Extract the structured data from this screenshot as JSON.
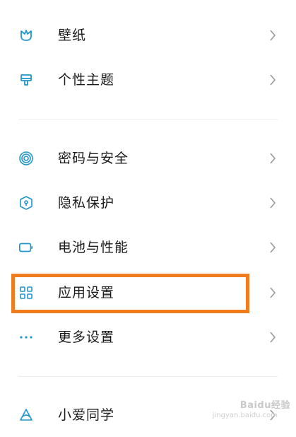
{
  "colors": {
    "accent": "#2196c9",
    "highlight_border": "#f07c20",
    "chevron": "#9a9a9a",
    "divider": "#eeeeee"
  },
  "sections": [
    {
      "items": [
        {
          "label": "壁纸",
          "icon": "wallpaper-icon"
        },
        {
          "label": "个性主题",
          "icon": "theme-brush-icon"
        }
      ]
    },
    {
      "items": [
        {
          "label": "密码与安全",
          "icon": "fingerprint-icon"
        },
        {
          "label": "隐私保护",
          "icon": "privacy-shield-icon"
        },
        {
          "label": "电池与性能",
          "icon": "battery-icon"
        },
        {
          "label": "应用设置",
          "icon": "apps-grid-icon"
        },
        {
          "label": "更多设置",
          "icon": "more-dots-icon"
        }
      ]
    },
    {
      "items": [
        {
          "label": "小爱同学",
          "icon": "xiaoai-icon"
        }
      ]
    }
  ],
  "watermark": {
    "text": "Baidu经验",
    "sub": "jingyan.baidu.com"
  }
}
